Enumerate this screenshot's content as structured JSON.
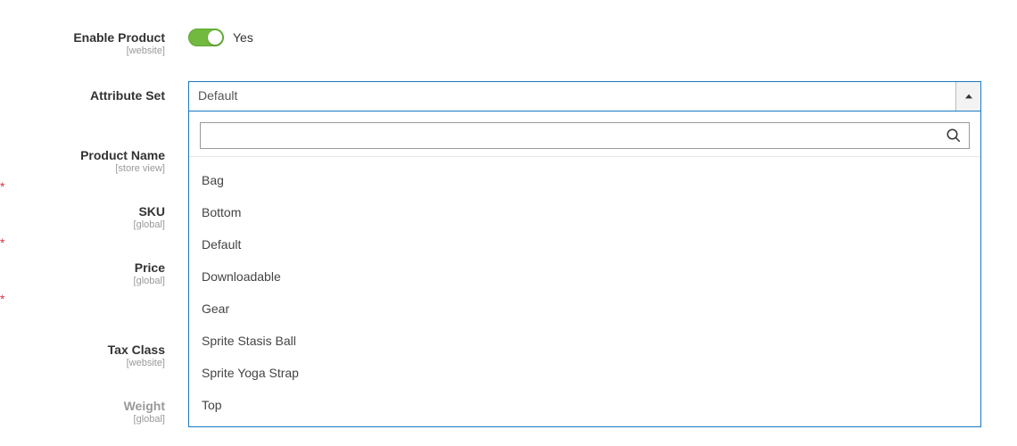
{
  "fields": {
    "enable_product": {
      "label": "Enable Product",
      "scope": "[website]",
      "value_label": "Yes"
    },
    "attribute_set": {
      "label": "Attribute Set",
      "selected": "Default"
    },
    "product_name": {
      "label": "Product Name",
      "scope": "[store view]"
    },
    "sku": {
      "label": "SKU",
      "scope": "[global]"
    },
    "price": {
      "label": "Price",
      "scope": "[global]"
    },
    "tax_class": {
      "label": "Tax Class",
      "scope": "[website]"
    },
    "weight": {
      "label": "Weight",
      "scope": "[global]"
    }
  },
  "required_marker": "*",
  "attribute_set_options": [
    "Bag",
    "Bottom",
    "Default",
    "Downloadable",
    "Gear",
    "Sprite Stasis Ball",
    "Sprite Yoga Strap",
    "Top"
  ]
}
